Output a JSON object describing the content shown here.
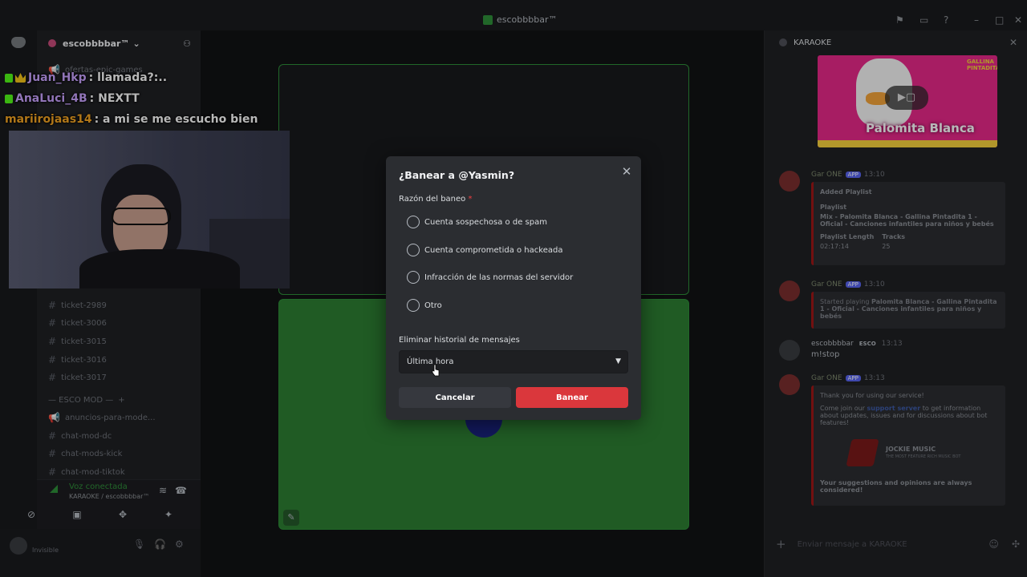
{
  "window": {
    "title": "escobbbbar™"
  },
  "sidebar": {
    "guild_name": "escobbbbar™",
    "channels": [
      {
        "name": "ofertas-epic-games"
      },
      {
        "name": "ticket-2989"
      },
      {
        "name": "ticket-3006"
      },
      {
        "name": "ticket-3015"
      },
      {
        "name": "ticket-3016"
      },
      {
        "name": "ticket-3017"
      },
      {
        "name": "anuncios-para-mode..."
      },
      {
        "name": "chat-mod-dc"
      },
      {
        "name": "chat-mods-kick"
      },
      {
        "name": "chat-mod-tiktok"
      }
    ],
    "category": "— ESCO MOD —",
    "voice": {
      "status": "Voz conectada",
      "channel": "KARAOKE / escobbbbar™"
    },
    "user": {
      "status": "Invisible"
    }
  },
  "overlay_chat": [
    {
      "user": "Juan_Hkp",
      "text": ": llamada?:..",
      "color": "#c9a2ff"
    },
    {
      "user": "AnaLuci_4B",
      "text": ": NEXTT",
      "color": "#c9a2ff"
    },
    {
      "user": "mariirojaas14",
      "text": ": a mi se me escucho bien",
      "color": "#f5a623"
    }
  ],
  "right_panel": {
    "title": "KARAOKE",
    "video_thumbnail": {
      "caption": "Palomita Blanca",
      "brand": "GALLINA PINTADITA"
    },
    "messages": [
      {
        "author": "Gar ONE",
        "tag": "APP",
        "time": "13:10",
        "embed": {
          "heading": "Added Playlist",
          "playlist_label": "Playlist",
          "playlist_value": "Mix - Palomita Blanca - Gallina Pintadita 1 - Oficial - Canciones infantiles para niños y bebés",
          "length_label": "Playlist Length",
          "length_value": "02:17:14",
          "tracks_label": "Tracks",
          "tracks_value": "25"
        }
      },
      {
        "author": "Gar ONE",
        "tag": "APP",
        "time": "13:10",
        "text_prefix": "Started playing ",
        "text_bold": "Palomita Blanca - Gallina Pintadita 1 - Oficial - Canciones infantiles para niños y bebés"
      },
      {
        "author": "escobbbbar",
        "tag": "ESCO",
        "time": "13:13",
        "text": "m!stop"
      },
      {
        "author": "Gar ONE",
        "tag": "APP",
        "time": "13:13",
        "embed": {
          "line1": "Thank you for using our service!",
          "line2_prefix": "Come join our ",
          "line2_link": "support server",
          "line2_suffix": " to get information about updates, issues and for discussions about bot features!",
          "logo_title": "JOCKIE MUSIC",
          "logo_sub": "THE MOST FEATURE RICH MUSIC BOT",
          "footer": "Your suggestions and opinions are always considered!"
        }
      }
    ],
    "input_placeholder": "Enviar mensaje a KARAOKE"
  },
  "dialog": {
    "title": "¿Banear a @Yasmin?",
    "reason_label": "Razón del baneo",
    "required_mark": "*",
    "options": [
      "Cuenta sospechosa o de spam",
      "Cuenta comprometida o hackeada",
      "Infracción de las normas del servidor",
      "Otro"
    ],
    "history_label": "Eliminar historial de mensajes",
    "history_value": "Última hora",
    "cancel_label": "Cancelar",
    "ban_label": "Banear"
  },
  "colors": {
    "ban": "#da373c",
    "stage_green": "#2d7f32",
    "accent": "#5865f2"
  }
}
